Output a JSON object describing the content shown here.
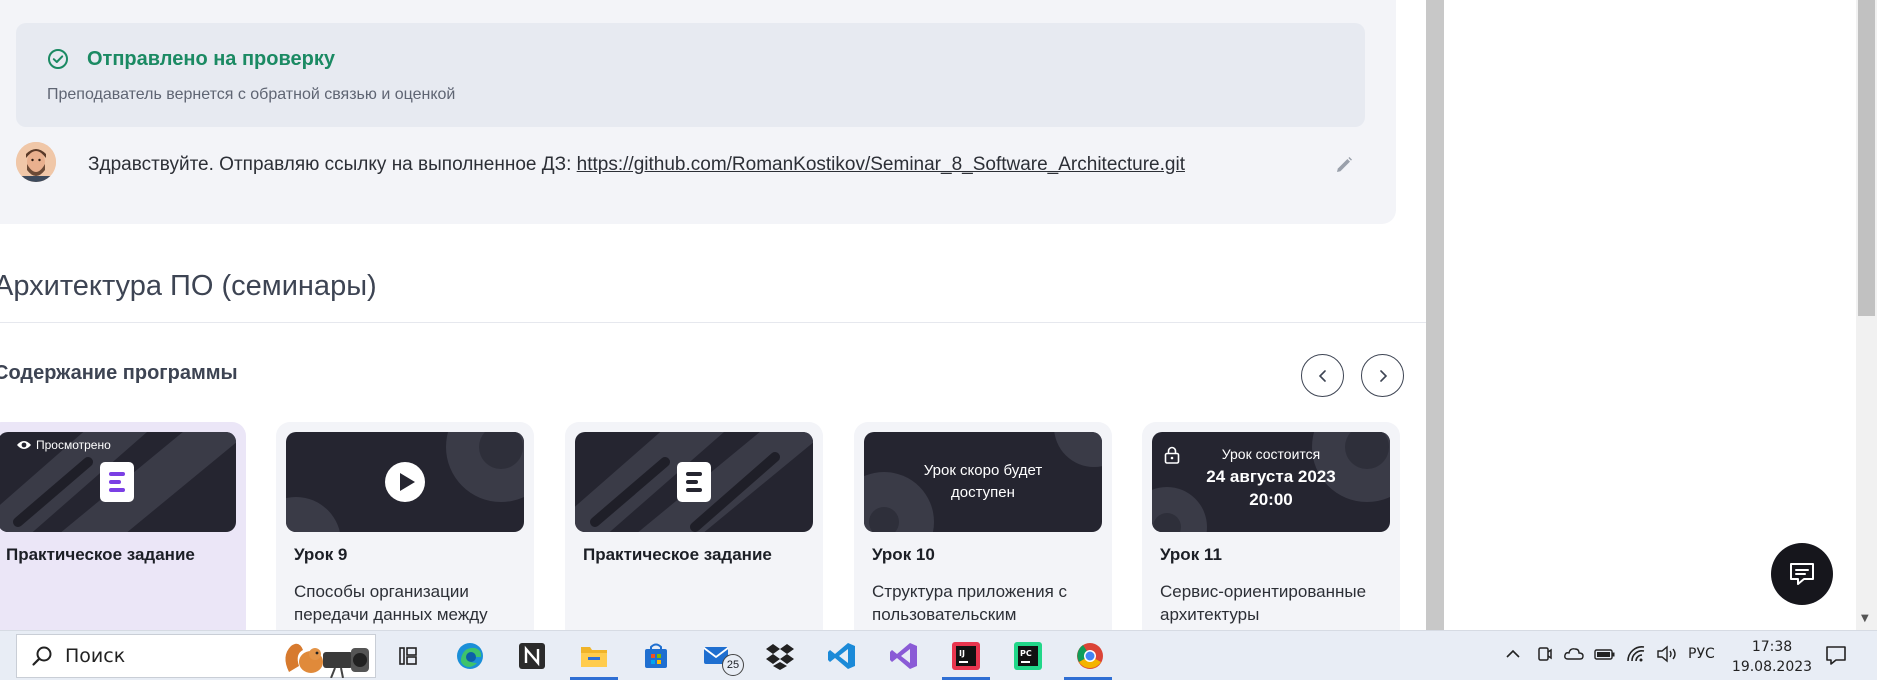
{
  "review": {
    "title": "Отправлено на проверку",
    "subtitle": "Преподаватель вернется с обратной связью и оценкой"
  },
  "comment": {
    "text_prefix": "Здравствуйте. Отправляю ссылку на выполненное ДЗ: ",
    "link": "https://github.com/RomanKostikov/Seminar_8_Software_Architecture.git"
  },
  "course": {
    "title": "Архитектура ПО (семинары)",
    "program_title": "Содержание программы"
  },
  "lessons": [
    {
      "badge": "Просмотрено",
      "name": "Практическое задание",
      "desc": "",
      "icon": "document-icon"
    },
    {
      "name": "Урок 9",
      "desc": "Способы организации передачи данных между",
      "icon": "play-icon"
    },
    {
      "name": "Практическое задание",
      "desc": "",
      "icon": "document-icon"
    },
    {
      "name": "Урок 10",
      "thumb_text": "Урок скоро будет доступен",
      "desc": "Структура приложения с пользовательским интерфейсом",
      "icon": ""
    },
    {
      "name": "Урок 11",
      "thumb_line1": "Урок состоится",
      "thumb_date": "24 августа 2023",
      "thumb_time": "20:00",
      "desc": "Сервис-ориентированные архитектуры",
      "icon": "lock-icon"
    }
  ],
  "taskbar": {
    "search_placeholder": "Поиск",
    "mail_badge": "25",
    "language": "РУС",
    "time": "17:38",
    "date": "19.08.2023"
  },
  "colors": {
    "accent_green": "#1b8a63",
    "card_bg": "#f3f4f8",
    "thumb_bg": "#252530",
    "viewed_bg": "#ebe6f7"
  }
}
